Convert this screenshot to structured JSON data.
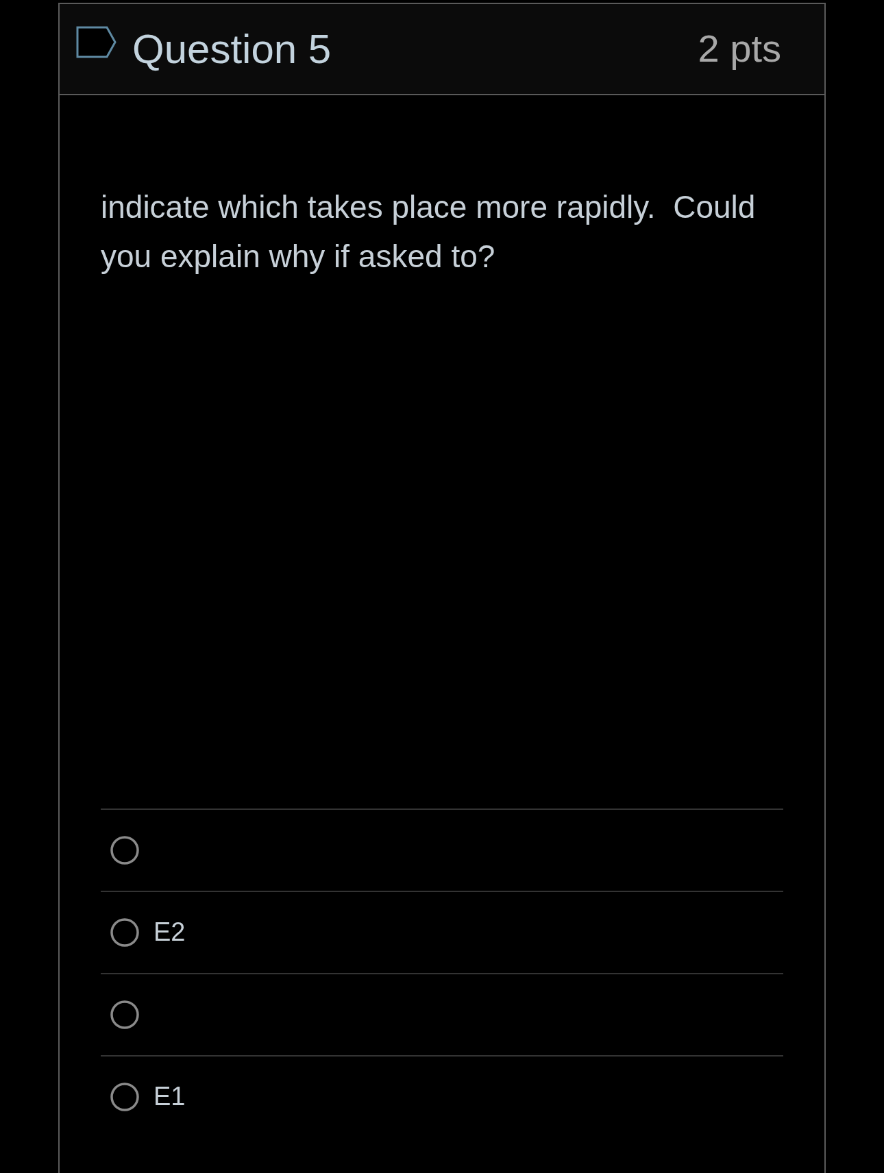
{
  "question": {
    "flagged": false,
    "title": "Question 5",
    "points": "2 pts"
  },
  "prompt": "indicate which takes place more rapidly.  Could you explain why if asked to?",
  "options": [
    {
      "selected": false
    },
    {
      "label": "E2",
      "selected": false
    },
    {
      "selected": false
    },
    {
      "label": "E1",
      "selected": false
    }
  ]
}
